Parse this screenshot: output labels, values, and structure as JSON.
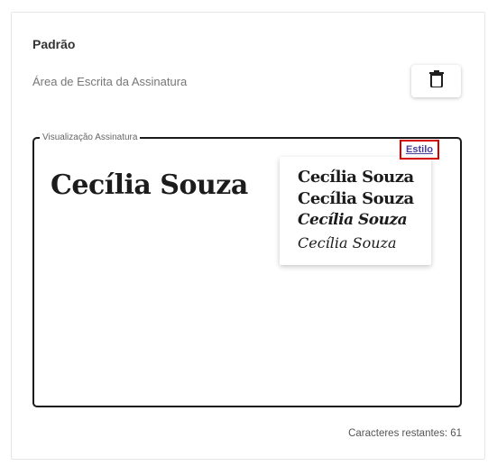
{
  "section": {
    "title": "Padrão",
    "subtitle": "Área de Escrita da Assinatura"
  },
  "delete_button": {
    "icon": "trash-icon"
  },
  "preview": {
    "legend": "Visualização Assinatura",
    "signature_text": "Cecília Souza",
    "style_link_label": "Estilo",
    "style_options": [
      "Cecília Souza",
      "Cecília Souza",
      "Cecília Souza",
      "Cecília Souza"
    ]
  },
  "footer": {
    "remaining_label": "Caracteres restantes: 61"
  },
  "colors": {
    "highlight_border": "#d40000",
    "link": "#4a3f9c",
    "frame": "#1a1a1a"
  }
}
